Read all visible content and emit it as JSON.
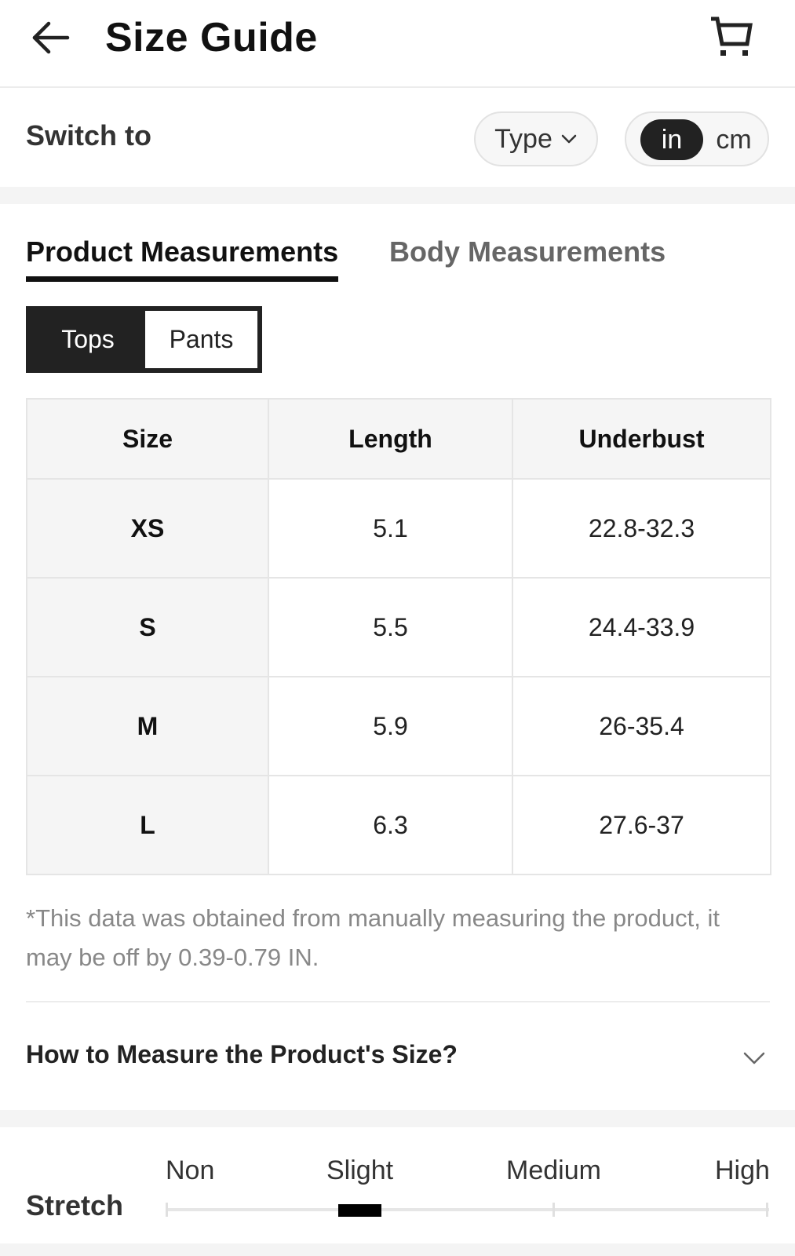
{
  "header": {
    "title": "Size Guide",
    "back_icon": "arrow-left-icon",
    "cart_icon": "cart-icon"
  },
  "switch_row": {
    "label": "Switch to",
    "type_label": "Type",
    "units": [
      "in",
      "cm"
    ],
    "selected_unit": "in"
  },
  "tabs": [
    {
      "label": "Product Measurements",
      "active": true
    },
    {
      "label": "Body Measurements",
      "active": false
    }
  ],
  "segment": {
    "options": [
      "Tops",
      "Pants"
    ],
    "selected": "Tops"
  },
  "table": {
    "headers": [
      "Size",
      "Length",
      "Underbust"
    ],
    "rows": [
      [
        "XS",
        "5.1",
        "22.8-32.3"
      ],
      [
        "S",
        "5.5",
        "24.4-33.9"
      ],
      [
        "M",
        "5.9",
        "26-35.4"
      ],
      [
        "L",
        "6.3",
        "27.6-37"
      ]
    ]
  },
  "note": "*This data was obtained from manually measuring the product, it may be off by 0.39-0.79 IN.",
  "how_to_measure": {
    "label": "How to Measure the Product's Size?"
  },
  "stretch": {
    "label": "Stretch",
    "levels": [
      "Non",
      "Slight",
      "Medium",
      "High"
    ],
    "selected_level": "Slight"
  },
  "colors": {
    "accent": "#222222",
    "muted_text": "#888888",
    "table_header_bg": "#f5f5f5",
    "border": "#e5e5e5"
  }
}
